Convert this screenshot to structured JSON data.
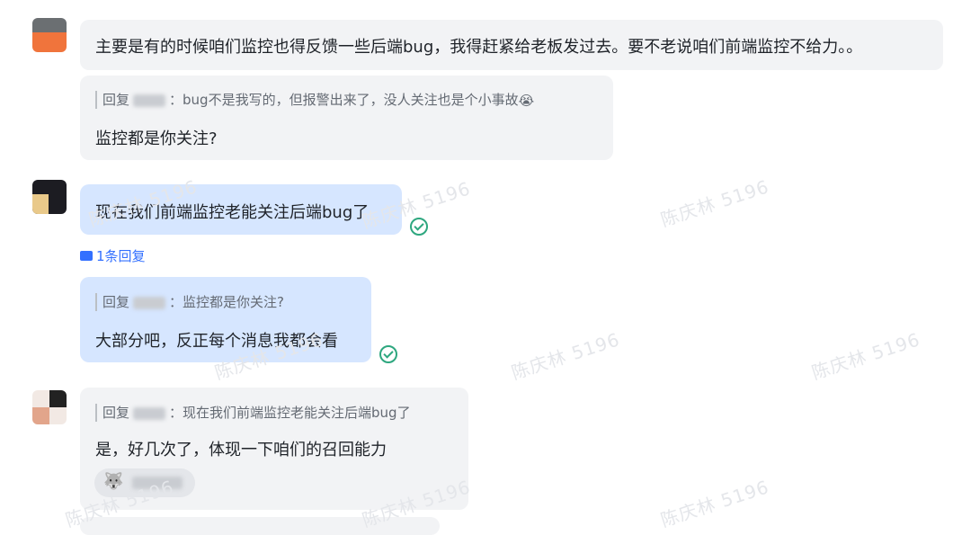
{
  "messages": {
    "m1": {
      "text": "主要是有的时候咱们监控也得反馈一些后端bug，我得赶紧给老板发过去。要不老说咱们前端监控不给力。。"
    },
    "m2": {
      "reply_prefix": "回复",
      "quote_text": "：bug不是我写的，但报警出来了，没人关注也是个小事故",
      "quote_emoji": "😭",
      "text": "监控都是你关注?"
    },
    "m3": {
      "text": "现在我们前端监控老能关注后端bug了",
      "reply_count": "1条回复"
    },
    "m4": {
      "reply_prefix": "回复",
      "quote_text": "：监控都是你关注?",
      "text": "大部分吧，反正每个消息我都会看"
    },
    "m5": {
      "reply_prefix": "回复",
      "quote_text": "：现在我们前端监控老能关注后端bug了",
      "text": "是，好几次了，体现一下咱们的召回能力",
      "reaction_emoji": "🐺"
    }
  },
  "watermark": "陈庆林 5196",
  "colors": {
    "read_check": "#2ea77f",
    "link": "#3370ff",
    "self_bubble": "#d6e6ff",
    "other_bubble": "#f2f3f5"
  }
}
